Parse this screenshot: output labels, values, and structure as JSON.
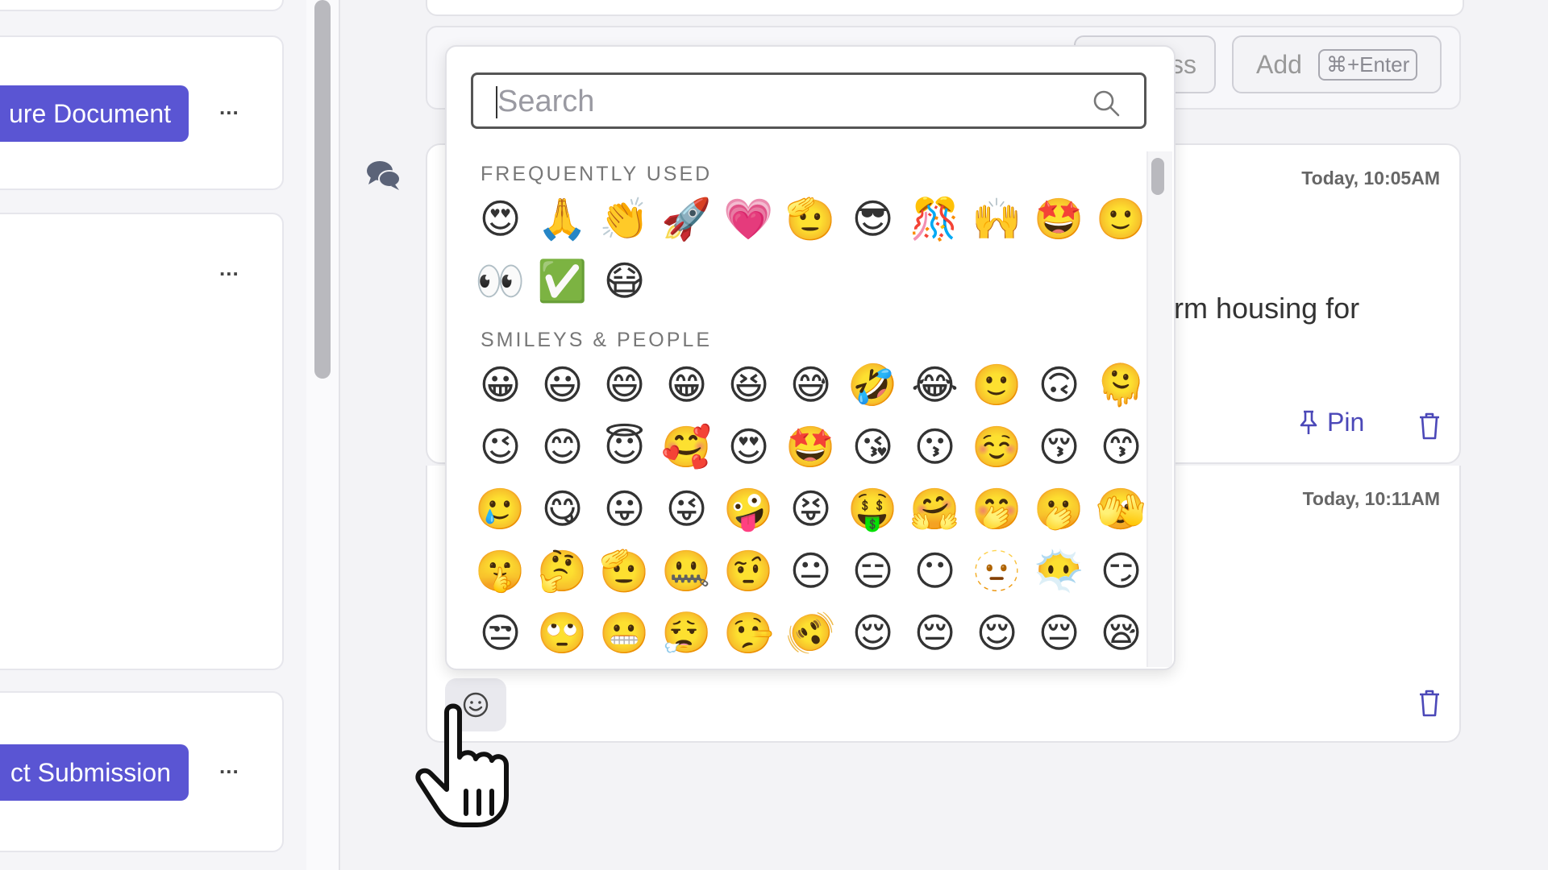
{
  "left_cards": [
    {
      "button": "ure Document",
      "more": "..."
    },
    {
      "button": "",
      "more": "..."
    },
    {
      "button": "ct Submission",
      "more": "..."
    }
  ],
  "composer": {
    "hidden_btn_partial": "ss",
    "add_label": "Add",
    "add_shortcut": "⌘+Enter"
  },
  "messages": [
    {
      "time": "Today, 10:05AM",
      "text_partial": "erm housing for",
      "pin_label": "Pin"
    },
    {
      "time": "Today, 10:11AM"
    }
  ],
  "emoji_picker": {
    "search_placeholder": "Search",
    "sections": [
      {
        "title": "FREQUENTLY USED",
        "emojis": [
          "😍",
          "🙏",
          "👏",
          "🚀",
          "💗",
          "🫡",
          "😎",
          "🎊",
          "🙌",
          "🤩",
          "🙂",
          "👀",
          "✅",
          "😷"
        ]
      },
      {
        "title": "SMILEYS & PEOPLE",
        "emojis": [
          "😀",
          "😃",
          "😄",
          "😁",
          "😆",
          "😅",
          "🤣",
          "😂",
          "🙂",
          "🙃",
          "🫠",
          "😉",
          "😊",
          "😇",
          "🥰",
          "😍",
          "🤩",
          "😘",
          "😗",
          "☺️",
          "😚",
          "😙",
          "🥲",
          "😋",
          "😛",
          "😜",
          "🤪",
          "😝",
          "🤑",
          "🤗",
          "🤭",
          "🫢",
          "🫣",
          "🤫",
          "🤔",
          "🫡",
          "🤐",
          "🤨",
          "😐",
          "😑",
          "😶",
          "🫥",
          "😶‍🌫️",
          "😏",
          "😒",
          "🙄",
          "😬",
          "😮‍💨",
          "🤥",
          "🫨",
          "😌",
          "😔",
          "😌",
          "😔",
          "😪"
        ]
      }
    ]
  }
}
